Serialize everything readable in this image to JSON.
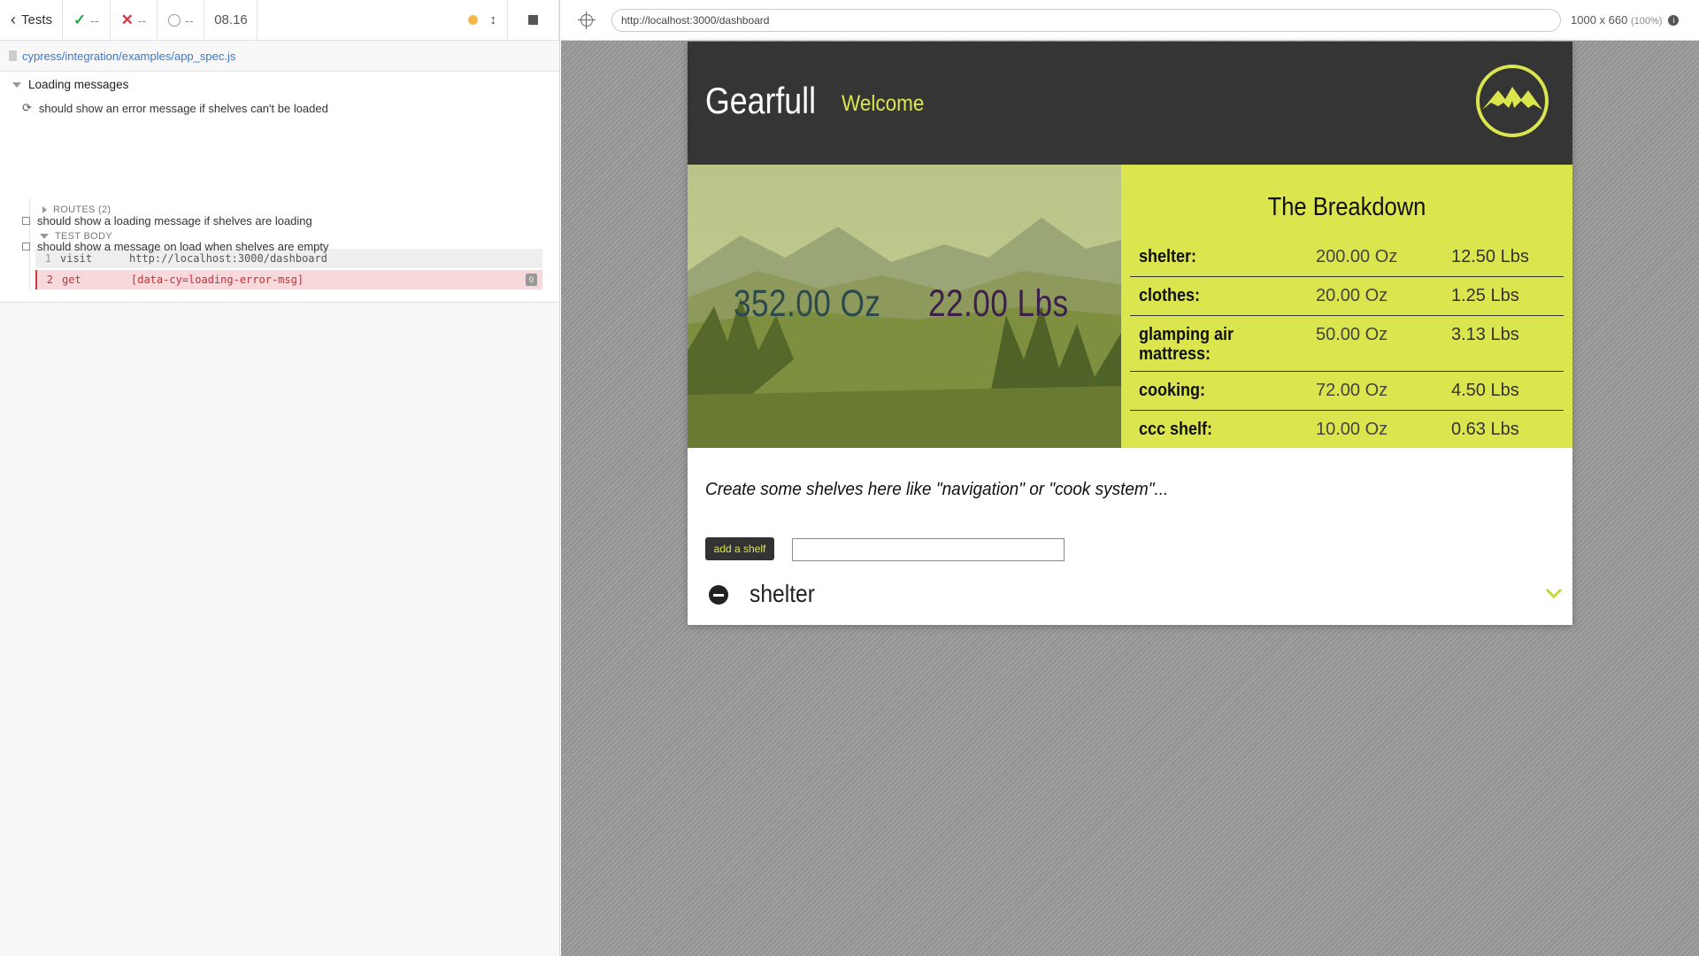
{
  "reporter": {
    "tests_label": "Tests",
    "passed": "--",
    "failed": "--",
    "pending": "--",
    "duration": "08.16",
    "spec_path": "cypress/integration/examples/app_spec.js",
    "suite_title": "Loading messages",
    "tests": [
      "should show an error message if shelves can't be loaded",
      "should show a loading message if shelves are loading",
      "should show a message on load when shelves are empty"
    ],
    "routes_label": "ROUTES (2)",
    "test_body_label": "TEST BODY",
    "commands": [
      {
        "num": "1",
        "name": "visit",
        "message": "http://localhost:3000/dashboard"
      },
      {
        "num": "2",
        "name": "get",
        "message": "[data-cy=loading-error-msg]",
        "badge": "0"
      }
    ]
  },
  "aut": {
    "url": "http://localhost:3000/dashboard",
    "viewport": "1000 x 660",
    "zoom": "(100%)"
  },
  "app": {
    "brand": "Gearfull",
    "welcome": "Welcome",
    "total_oz": "352.00 Oz",
    "total_lbs": "22.00 Lbs",
    "breakdown_title": "The Breakdown",
    "breakdown": [
      {
        "name": "shelter:",
        "oz": "200.00 Oz",
        "lbs": "12.50 Lbs"
      },
      {
        "name": "clothes:",
        "oz": "20.00 Oz",
        "lbs": "1.25 Lbs"
      },
      {
        "name": "glamping air mattress:",
        "oz": "50.00 Oz",
        "lbs": "3.13 Lbs"
      },
      {
        "name": "cooking:",
        "oz": "72.00 Oz",
        "lbs": "4.50 Lbs"
      },
      {
        "name": "ccc shelf:",
        "oz": "10.00 Oz",
        "lbs": "0.63 Lbs"
      }
    ],
    "intro": "Create some shelves here like \"navigation\" or \"cook system\"...",
    "add_button": "add a shelf",
    "input_value": "",
    "shelf_name": "shelter"
  },
  "colors": {
    "accent": "#dbe54e",
    "header_bg": "#353535",
    "error": "#d0363e",
    "link": "#3a77c9"
  }
}
